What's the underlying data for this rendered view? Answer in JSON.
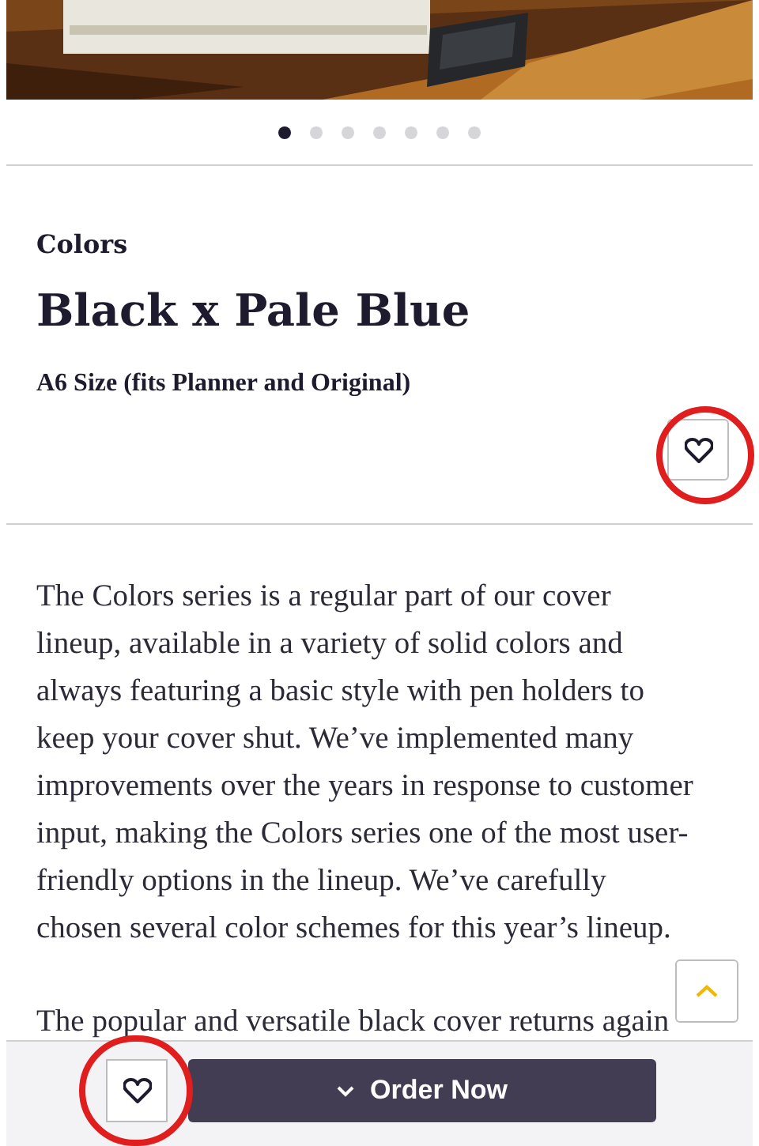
{
  "carousel": {
    "kind": "picture",
    "dots": [
      {
        "selected": true
      },
      {
        "selected": false
      },
      {
        "selected": false
      },
      {
        "selected": false
      },
      {
        "selected": false
      },
      {
        "selected": false
      },
      {
        "selected": false
      }
    ]
  },
  "product": {
    "series": "Colors",
    "title": "Black x Pale Blue",
    "size": "A6 Size (fits Planner and Original)"
  },
  "description": [
    "The Colors series is a regular part of our cover lineup, available in a variety of solid colors and always featuring a basic style with pen holders to keep your cover shut. We’ve implemented many improvements over the years in response to customer input, making the Colors series one of the most user-friendly options in the lineup. We’ve carefully chosen several color schemes for this year’s lineup.",
    "The popular and versatile black cover returns again"
  ],
  "order_button": {
    "label": "Order Now"
  }
}
